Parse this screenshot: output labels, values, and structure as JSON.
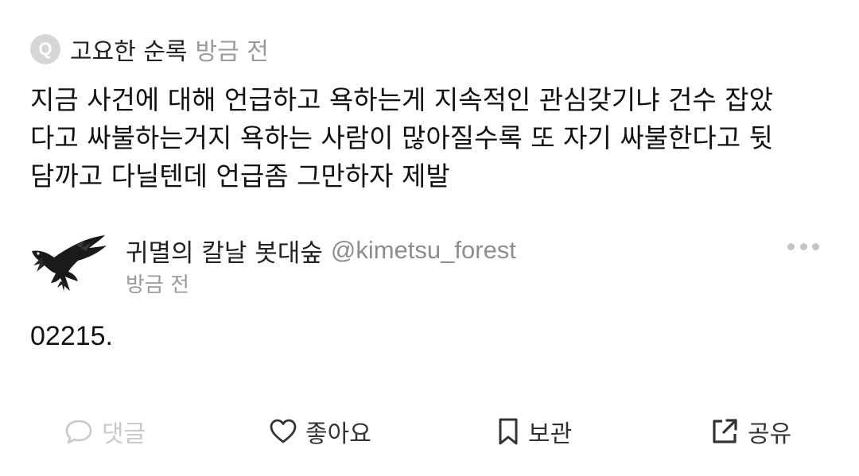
{
  "question": {
    "badge": "Q",
    "author": "고요한 순록",
    "time": "방금 전",
    "body_lines": [
      "지금 사건에 대해 언급하고 욕하는게 지속적인 관심갖기냐 건수 잡았",
      "다고 싸불하는거지 욕하는 사람이 많아질수록 또 자기 싸불한다고 뒷",
      "담까고 다닐텐데 언급좀 그만하자 제발"
    ]
  },
  "reply": {
    "author": "귀멸의 칼날 봇대숲",
    "handle": "@kimetsu_forest",
    "time": "방금 전",
    "body": "02215.",
    "avatar_icon": "crow-icon"
  },
  "actions": {
    "comment": {
      "label": "댓글",
      "icon": "speech-bubble-icon",
      "color": "#c9c9c9"
    },
    "like": {
      "label": "좋아요",
      "icon": "heart-icon",
      "color": "#333333"
    },
    "save": {
      "label": "보관",
      "icon": "bookmark-icon",
      "color": "#333333"
    },
    "share": {
      "label": "공유",
      "icon": "share-icon",
      "color": "#333333"
    }
  },
  "more_icon": "more-dots-icon"
}
